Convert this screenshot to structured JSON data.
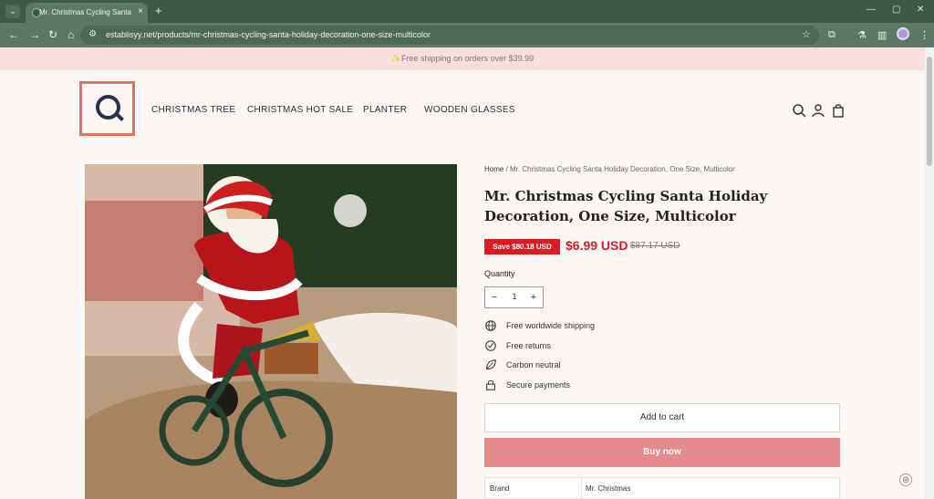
{
  "browser": {
    "tab_title": "Mr. Christmas Cycling Santa Ho",
    "url": "establisyy.net/products/mr-christmas-cycling-santa-holiday-decoration-one-size-multicolor"
  },
  "announcement": {
    "text": "✨Free shipping on orders over $39.99"
  },
  "header": {
    "nav": [
      {
        "label": "CHRISTMAS TREE"
      },
      {
        "label": "CHRISTMAS HOT SALE"
      },
      {
        "label": "PLANTER"
      },
      {
        "label": "WOODEN GLASSES"
      }
    ],
    "icons": [
      "search-icon",
      "account-icon",
      "cart-icon"
    ]
  },
  "product": {
    "breadcrumb": {
      "home": "Home",
      "separator": " / ",
      "current": "Mr. Christmas Cycling Santa Holiday Decoration, One Size, Multicolor"
    },
    "title": "Mr. Christmas Cycling Santa Holiday Decoration, One Size, Multicolor",
    "save_badge": "Save $80.18 USD",
    "price": "$6.99 USD",
    "compare_price": "$87.17 USD",
    "quantity": {
      "label": "Quantity",
      "value": "1",
      "minus": "−",
      "plus": "+"
    },
    "features": [
      {
        "icon": "globe-icon",
        "label": "Free worldwide shipping"
      },
      {
        "icon": "check-circle-icon",
        "label": "Free returns"
      },
      {
        "icon": "leaf-icon",
        "label": "Carbon neutral"
      },
      {
        "icon": "lock-icon",
        "label": "Secure payments"
      }
    ],
    "add_to_cart_label": "Add to cart",
    "buy_now_label": "Buy now",
    "specs": [
      {
        "key": "Brand",
        "value": "Mr. Christmas"
      }
    ]
  },
  "colors": {
    "accent_red": "#d91c24",
    "buy_now": "#e48c8c",
    "logo_orange": "#e0735d",
    "browser_green": "#5a7a66"
  }
}
